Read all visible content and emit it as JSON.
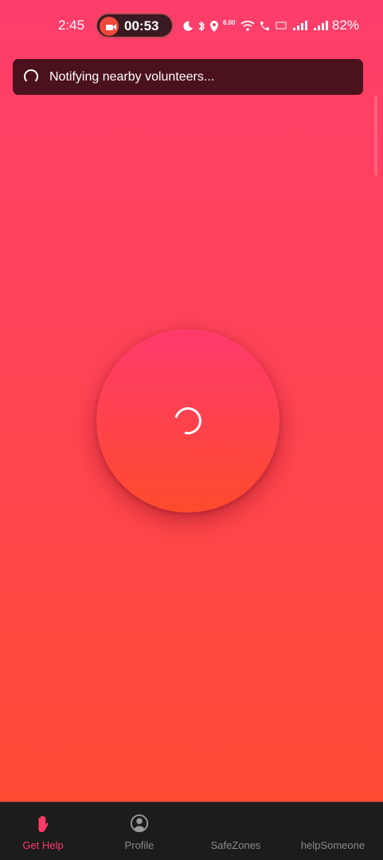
{
  "status_bar": {
    "time": "2:45",
    "recording_timer": "00:53",
    "network_speed": "6.00",
    "battery": "82%"
  },
  "toast": {
    "message": "Notifying nearby volunteers..."
  },
  "help_button": {
    "state": "loading"
  },
  "bottom_nav": {
    "items": [
      {
        "label": "Get Help",
        "icon": "raised-hand-icon",
        "active": true
      },
      {
        "label": "Profile",
        "icon": "user-circle-icon",
        "active": false
      },
      {
        "label": "SafeZones",
        "icon": "",
        "active": false
      },
      {
        "label": "helpSomeone",
        "icon": "",
        "active": false
      }
    ]
  },
  "colors": {
    "accent": "#ff3b6a",
    "gradient_top": "#ff3d6b",
    "gradient_bottom": "#ff4a2e",
    "nav_background": "#1c1c1c"
  }
}
